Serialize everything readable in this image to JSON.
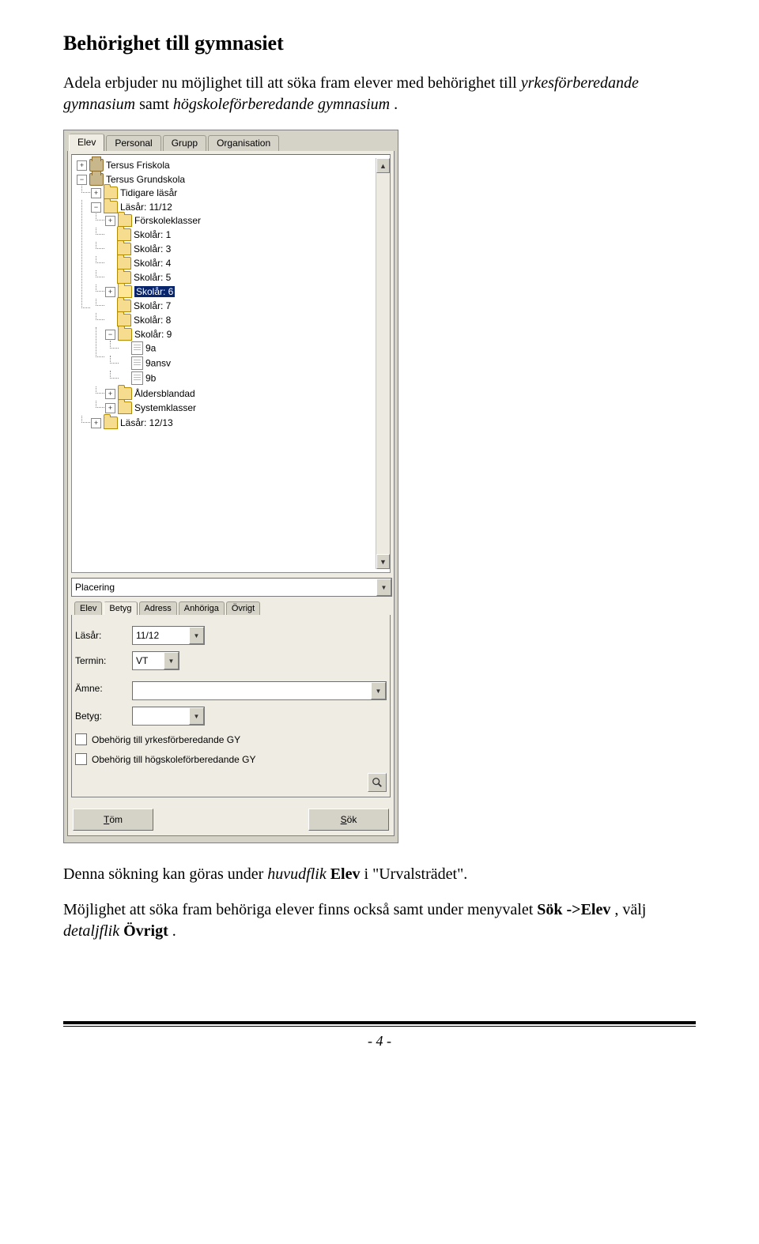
{
  "doc": {
    "heading": "Behörighet till gymnasiet",
    "intro_plain_prefix": "Adela erbjuder nu möjlighet till att söka fram elever med behörighet till ",
    "intro_em1": "yrkesförberedande gymnasium",
    "intro_mid": " samt ",
    "intro_em2": "högskoleförberedande gymnasium",
    "intro_suffix": ".",
    "para2_prefix": "Denna sökning kan göras under ",
    "para2_em": "huvudflik",
    "para2_mid": " ",
    "para2_strong": "Elev",
    "para2_after_strong": " i ",
    "para2_quote": "\"Urvalsträdet\".",
    "para3_prefix": "Möjlighet att söka fram behöriga elever finns också samt under menyvalet ",
    "para3_strong": "Sök ->Elev",
    "para3_mid": ", välj ",
    "para3_em": "detaljflik",
    "para3_tail": " ",
    "para3_strong2": "Övrigt",
    "para3_suffix": ".",
    "page_num": "- 4 -"
  },
  "app": {
    "main_tabs": [
      "Elev",
      "Personal",
      "Grupp",
      "Organisation"
    ],
    "tree": {
      "nodes": [
        {
          "icon": "school",
          "label": "Tersus Friskola",
          "toggle": "+"
        },
        {
          "icon": "school",
          "label": "Tersus Grundskola",
          "toggle": "-",
          "children": [
            {
              "icon": "folder",
              "label": "Tidigare läsår",
              "toggle": "+"
            },
            {
              "icon": "folder",
              "label": "Läsår: 11/12",
              "toggle": "-",
              "children": [
                {
                  "icon": "folder",
                  "label": "Förskoleklasser",
                  "toggle": "+"
                },
                {
                  "icon": "folder",
                  "label": "Skolår: 1"
                },
                {
                  "icon": "folder",
                  "label": "Skolår: 3"
                },
                {
                  "icon": "folder",
                  "label": "Skolår: 4"
                },
                {
                  "icon": "folder",
                  "label": "Skolår: 5"
                },
                {
                  "icon": "folder",
                  "label": "Skolår: 6",
                  "selected": true,
                  "toggle": "+"
                },
                {
                  "icon": "folder",
                  "label": "Skolår: 7"
                },
                {
                  "icon": "folder",
                  "label": "Skolår: 8"
                },
                {
                  "icon": "folder",
                  "label": "Skolår: 9",
                  "toggle": "-",
                  "children": [
                    {
                      "icon": "doc",
                      "label": "9a"
                    },
                    {
                      "icon": "doc",
                      "label": "9ansv"
                    },
                    {
                      "icon": "doc",
                      "label": "9b"
                    }
                  ]
                },
                {
                  "icon": "folder",
                  "label": "Åldersblandad",
                  "toggle": "+"
                },
                {
                  "icon": "folder",
                  "label": "Systemklasser",
                  "toggle": "+"
                }
              ]
            },
            {
              "icon": "folder",
              "label": "Läsår: 12/13",
              "toggle": "+"
            }
          ]
        }
      ]
    },
    "placering_combo": "Placering",
    "detail_tabs": [
      "Elev",
      "Betyg",
      "Adress",
      "Anhöriga",
      "Övrigt"
    ],
    "lasar_label": "Läsår:",
    "lasar_value": "11/12",
    "termin_label": "Termin:",
    "termin_value": "VT",
    "amne_label": "Ämne:",
    "amne_value": "",
    "betyg_label": "Betyg:",
    "betyg_value": "",
    "cb1": "Obehörig till yrkesförberedande GY",
    "cb2": "Obehörig till högskoleförberedande GY",
    "btn_tom_u": "T",
    "btn_tom_rest": "öm",
    "btn_sok_u": "S",
    "btn_sok_rest": "ök"
  }
}
